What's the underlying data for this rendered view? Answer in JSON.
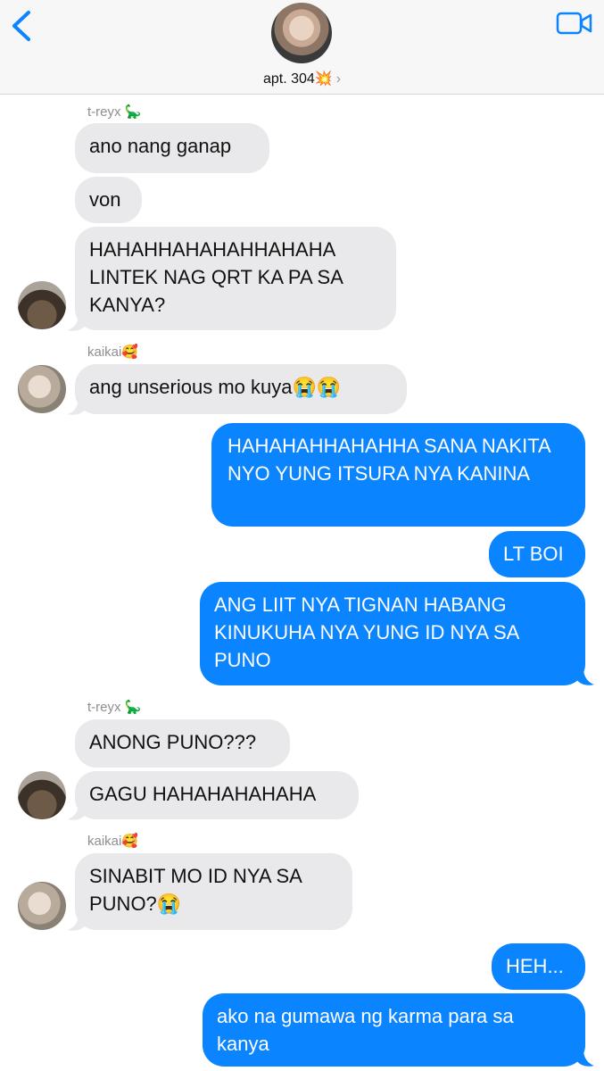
{
  "header": {
    "group_name": "apt. 304💥",
    "chevron": "›",
    "back_icon": "chevron-left-icon",
    "video_icon": "video-camera-icon",
    "accent_color": "#0a84ff"
  },
  "messages": [
    {
      "sender": "t-reyx 🦕",
      "text": "ano nang ganap"
    },
    {
      "text": "von"
    },
    {
      "text": "HAHAHHAHAHAHHAHAHA LINTEK NAG QRT KA PA SA KANYA?"
    },
    {
      "sender": "kaikai🥰",
      "text": "ang unserious mo kuya😭😭"
    },
    {
      "text": "HAHAHAHHAHAHHA SANA NAKITA NYO YUNG ITSURA NYA KANINA"
    },
    {
      "text": "LT BOI"
    },
    {
      "text": "ANG LIIT NYA TIGNAN HABANG KINUKUHA NYA YUNG ID NYA SA PUNO"
    },
    {
      "sender": "t-reyx 🦕",
      "text": "ANONG PUNO???"
    },
    {
      "text": "GAGU HAHAHAHAHAHA"
    },
    {
      "sender": "kaikai🥰",
      "text": "SINABIT MO ID NYA SA PUNO?😭"
    },
    {
      "text": "HEH..."
    },
    {
      "text": "ako na gumawa ng karma para sa kanya"
    }
  ]
}
